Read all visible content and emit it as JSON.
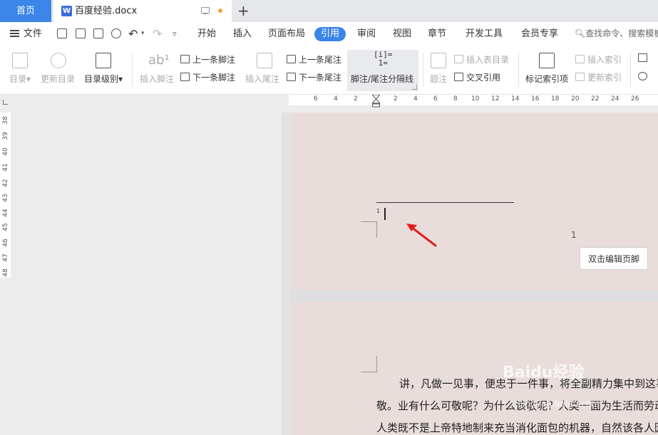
{
  "tabs": {
    "home": "首页",
    "doc": {
      "icon": "W",
      "title": "百度经验.docx"
    },
    "new_tab": "+"
  },
  "menu": {
    "file": "文件",
    "items": [
      "开始",
      "插入",
      "页面布局",
      "引用",
      "审阅",
      "视图",
      "章节",
      "开发工具",
      "会员专享"
    ],
    "active": "引用",
    "search": "查找命令、搜索模板"
  },
  "ribbon": {
    "toc": "目录",
    "update_toc": "更新目录",
    "toc_level": "目录级别",
    "insert_footnote": "插入脚注",
    "prev_footnote": "上一条脚注",
    "next_footnote": "下一条脚注",
    "insert_endnote": "插入尾注",
    "prev_endnote": "上一条尾注",
    "next_endnote": "下一条尾注",
    "separator": "脚注/尾注分隔线",
    "caption": "题注",
    "insert_table_toc": "插入表目录",
    "cross_ref": "交叉引用",
    "mark_index": "标记索引项",
    "insert_index": "插入索引",
    "update_index": "更新索引"
  },
  "ruler": {
    "h_ticks": [
      "6",
      "4",
      "2",
      "2",
      "4",
      "6",
      "8",
      "10",
      "12",
      "14",
      "16",
      "18",
      "20",
      "22",
      "24",
      "26"
    ],
    "v_ticks": [
      "38",
      "39",
      "40",
      "41",
      "42",
      "43",
      "44",
      "45",
      "46",
      "47",
      "48"
    ]
  },
  "document": {
    "footnote_number": "1",
    "page_number": "1",
    "footer_button": "双击编辑页脚",
    "body_lines": [
      "讲，凡做一见事，便忠于一件事，将全副精力集中到这事",
      "敬。业有什么可敬呢？为什么该敬呢？人类一面为生活而劳动",
      "人类既不是上帝特地制来充当消化面包的机器，自然该各人因"
    ],
    "watermark": "Baidu经验",
    "watermark_url": "jingyan.baidu.com"
  },
  "colors": {
    "accent": "#3b85e8",
    "page": "#e8ddda",
    "arrow": "#e02020"
  }
}
